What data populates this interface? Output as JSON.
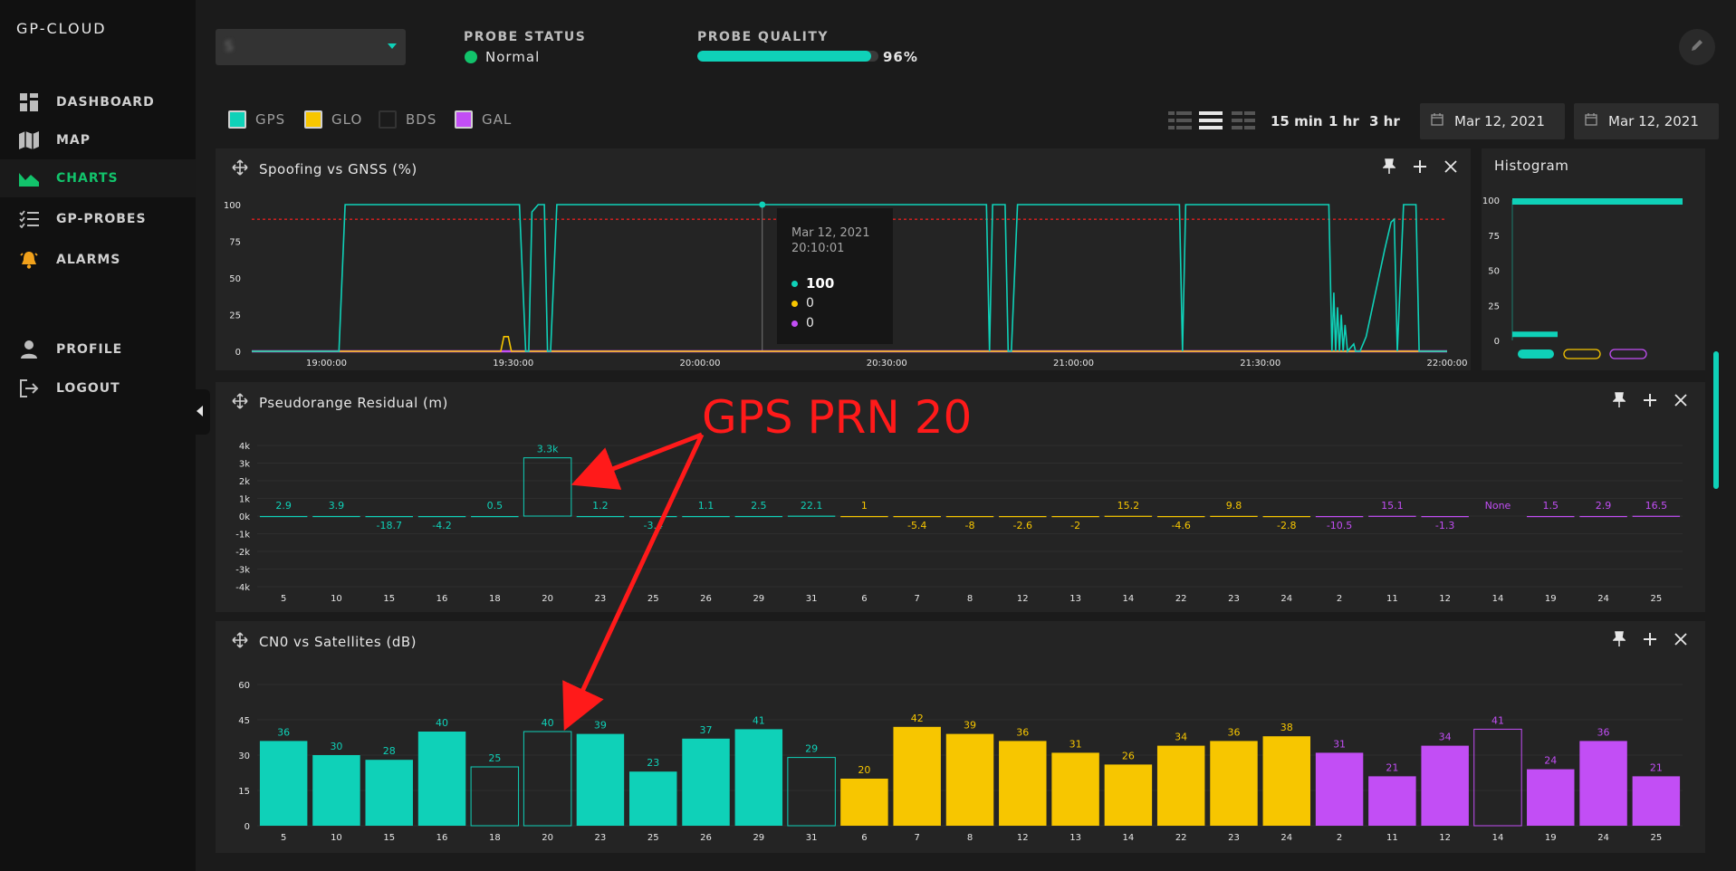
{
  "app": {
    "brand": "GP-CLOUD"
  },
  "sidebar": {
    "items": [
      {
        "label": "DASHBOARD",
        "icon": "grid-icon"
      },
      {
        "label": "MAP",
        "icon": "map-icon"
      },
      {
        "label": "CHARTS",
        "icon": "area-chart-icon",
        "active": true
      },
      {
        "label": "GP-PROBES",
        "icon": "list-icon"
      },
      {
        "label": "ALARMS",
        "icon": "bell-icon"
      },
      {
        "label": "PROFILE",
        "icon": "user-icon"
      },
      {
        "label": "LOGOUT",
        "icon": "logout-icon"
      }
    ]
  },
  "header": {
    "probe_select_value": "S",
    "probe_status_label": "PROBE STATUS",
    "probe_status_value": "Normal",
    "probe_quality_label": "PROBE QUALITY",
    "probe_quality_value": "96%",
    "probe_quality_fraction": 0.96
  },
  "filters": {
    "constellations": [
      {
        "label": "GPS",
        "color": "#0fd1b8",
        "filled": true
      },
      {
        "label": "GLO",
        "color": "#f7c600",
        "filled": true
      },
      {
        "label": "BDS",
        "color": "#333333",
        "filled": false
      },
      {
        "label": "GAL",
        "color": "#c24ef5",
        "filled": true
      }
    ],
    "ranges": [
      "15 min",
      "1 hr",
      "3 hr"
    ],
    "date_from": "Mar 12, 2021",
    "date_to": "Mar 12, 2021"
  },
  "colors": {
    "gps": "#0fd1b8",
    "glo": "#f7c600",
    "gal": "#c24ef5",
    "threshold": "#e02020"
  },
  "spoofing": {
    "title": "Spoofing vs GNSS (%)",
    "tooltip": {
      "date": "Mar 12, 2021",
      "time": "20:10:01",
      "values": [
        "100",
        "0",
        "0"
      ]
    },
    "chart_data": {
      "type": "line",
      "title": "Spoofing vs GNSS (%)",
      "x_ticks": [
        "19:00:00",
        "19:30:00",
        "20:00:00",
        "20:30:00",
        "21:00:00",
        "21:30:00",
        "22:00:00"
      ],
      "y_ticks": [
        0,
        25,
        50,
        75,
        100
      ],
      "ylim": [
        0,
        100
      ],
      "xlim_minutes": [
        -12,
        180
      ],
      "threshold": 90,
      "series": [
        {
          "color": "gps",
          "points": [
            [
              -12,
              0
            ],
            [
              2,
              0
            ],
            [
              3,
              100
            ],
            [
              31,
              100
            ],
            [
              32,
              0
            ],
            [
              32.5,
              0
            ],
            [
              33,
              95
            ],
            [
              34,
              100
            ],
            [
              35,
              100
            ],
            [
              35.5,
              0
            ],
            [
              36,
              0
            ],
            [
              37,
              100
            ],
            [
              106,
              100
            ],
            [
              106.5,
              0
            ],
            [
              107,
              100
            ],
            [
              109,
              100
            ],
            [
              109.5,
              0
            ],
            [
              110,
              0
            ],
            [
              111,
              100
            ],
            [
              137,
              100
            ],
            [
              137.5,
              0
            ],
            [
              138,
              100
            ],
            [
              161,
              100
            ],
            [
              161.5,
              0
            ],
            [
              161.8,
              40
            ],
            [
              162.1,
              0
            ],
            [
              162.4,
              30
            ],
            [
              162.7,
              0
            ],
            [
              163,
              25
            ],
            [
              163.3,
              0
            ],
            [
              163.6,
              18
            ],
            [
              164,
              0
            ],
            [
              165,
              5
            ],
            [
              165.3,
              0
            ],
            [
              166,
              0
            ],
            [
              166.5,
              5
            ],
            [
              167,
              10
            ],
            [
              168,
              30
            ],
            [
              169,
              50
            ],
            [
              170,
              70
            ],
            [
              171,
              88
            ],
            [
              171.5,
              90
            ],
            [
              172,
              0
            ],
            [
              173,
              100
            ],
            [
              175,
              100
            ],
            [
              175.5,
              0
            ],
            [
              180,
              0
            ]
          ]
        },
        {
          "color": "glo",
          "points": [
            [
              -12,
              0
            ],
            [
              28,
              0
            ],
            [
              28.5,
              10
            ],
            [
              29.2,
              10
            ],
            [
              29.7,
              0
            ],
            [
              180,
              0
            ]
          ]
        },
        {
          "color": "gal",
          "points": [
            [
              -12,
              0
            ],
            [
              180,
              0
            ]
          ]
        }
      ]
    }
  },
  "histogram": {
    "title": "Histogram",
    "chart_data": {
      "type": "bar",
      "y_ticks": [
        0,
        25,
        50,
        75,
        100
      ],
      "ylim": [
        0,
        100
      ],
      "categories": [
        "100",
        "0"
      ],
      "values": [
        100,
        5
      ]
    }
  },
  "pseudorange": {
    "title": "Pseudorange Residual (m)",
    "chart_data": {
      "type": "bar",
      "title": "Pseudorange Residual (m)",
      "y_ticks": [
        "4k",
        "3k",
        "2k",
        "1k",
        "0k",
        "-1k",
        "-2k",
        "-3k",
        "-4k"
      ],
      "ylim": [
        -4000,
        4000
      ],
      "categories": [
        "5",
        "10",
        "15",
        "16",
        "18",
        "20",
        "23",
        "25",
        "26",
        "29",
        "31",
        "6",
        "7",
        "8",
        "12",
        "13",
        "14",
        "22",
        "23",
        "24",
        "2",
        "11",
        "12",
        "14",
        "19",
        "24",
        "25"
      ],
      "constellation": [
        "gps",
        "gps",
        "gps",
        "gps",
        "gps",
        "gps",
        "gps",
        "gps",
        "gps",
        "gps",
        "gps",
        "glo",
        "glo",
        "glo",
        "glo",
        "glo",
        "glo",
        "glo",
        "glo",
        "glo",
        "gal",
        "gal",
        "gal",
        "gal",
        "gal",
        "gal",
        "gal"
      ],
      "values": [
        2.9,
        3.9,
        -18.7,
        -4.2,
        0.5,
        3300,
        1.2,
        -3.4,
        1.1,
        2.5,
        22.1,
        1,
        -5.4,
        -8,
        -2.6,
        -2,
        15.2,
        -4.6,
        9.8,
        -2.8,
        -10.5,
        15.1,
        -1.3,
        null,
        1.5,
        2.9,
        16.5
      ],
      "labels": [
        "2.9",
        "3.9",
        "-18.7",
        "-4.2",
        "0.5",
        "3.3k",
        "1.2",
        "-3.4",
        "1.1",
        "2.5",
        "22.1",
        "1",
        "-5.4",
        "-8",
        "-2.6",
        "-2",
        "15.2",
        "-4.6",
        "9.8",
        "-2.8",
        "-10.5",
        "15.1",
        "-1.3",
        "None",
        "1.5",
        "2.9",
        "16.5"
      ],
      "outlined": [
        5
      ]
    }
  },
  "cno": {
    "title": "CN0 vs Satellites (dB)",
    "chart_data": {
      "type": "bar",
      "title": "CN0 vs Satellites (dB)",
      "y_ticks": [
        0,
        15,
        30,
        45,
        60
      ],
      "ylim": [
        0,
        60
      ],
      "categories": [
        "5",
        "10",
        "15",
        "16",
        "18",
        "20",
        "23",
        "25",
        "26",
        "29",
        "31",
        "6",
        "7",
        "8",
        "12",
        "13",
        "14",
        "22",
        "23",
        "24",
        "2",
        "11",
        "12",
        "14",
        "19",
        "24",
        "25"
      ],
      "constellation": [
        "gps",
        "gps",
        "gps",
        "gps",
        "gps",
        "gps",
        "gps",
        "gps",
        "gps",
        "gps",
        "gps",
        "glo",
        "glo",
        "glo",
        "glo",
        "glo",
        "glo",
        "glo",
        "glo",
        "glo",
        "gal",
        "gal",
        "gal",
        "gal",
        "gal",
        "gal",
        "gal"
      ],
      "values": [
        36,
        30,
        28,
        40,
        25,
        40,
        39,
        23,
        37,
        41,
        29,
        20,
        42,
        39,
        36,
        31,
        26,
        34,
        36,
        38,
        31,
        21,
        34,
        41,
        24,
        36,
        21
      ],
      "outlined": [
        4,
        5,
        10,
        23
      ]
    }
  },
  "annotation": {
    "text": "GPS PRN 20"
  }
}
